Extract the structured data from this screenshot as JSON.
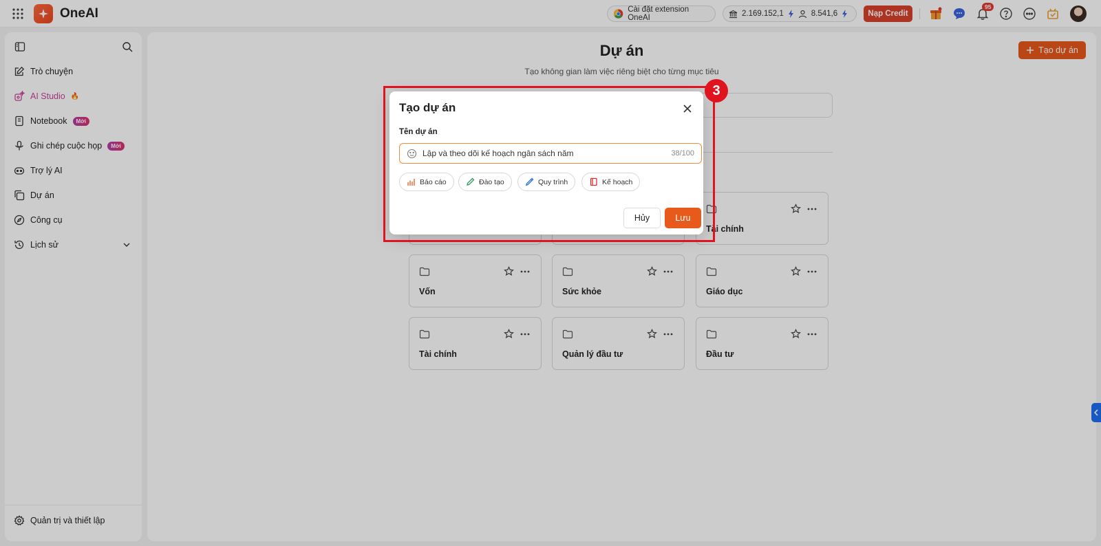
{
  "app": {
    "brand": "OneAI"
  },
  "topbar": {
    "extension_label": "Cài đặt extension OneAI",
    "credit_balance": "2.169.152,1",
    "user_credit": "8.541,6",
    "nap_credit_label": "Nạp Credit",
    "notification_count": "95"
  },
  "sidebar": {
    "items": [
      {
        "label": "Trò chuyện"
      },
      {
        "label": "AI Studio",
        "badge": "🔥"
      },
      {
        "label": "Notebook",
        "badge": "Mới"
      },
      {
        "label": "Ghi chép cuộc họp",
        "badge": "Mới"
      },
      {
        "label": "Trợ lý AI"
      },
      {
        "label": "Dự án"
      },
      {
        "label": "Công cụ"
      },
      {
        "label": "Lịch sử"
      }
    ],
    "bottom_label": "Quản trị và thiết lập"
  },
  "main": {
    "title": "Dự án",
    "subtitle": "Tạo không gian làm việc riêng biệt cho từng mục tiêu",
    "create_button": "Tạo dự án",
    "projects": [
      {
        "name": ""
      },
      {
        "name": ""
      },
      {
        "name": "Tài chính"
      },
      {
        "name": "Vốn"
      },
      {
        "name": "Sức khỏe"
      },
      {
        "name": "Giáo dục"
      },
      {
        "name": "Tài chính"
      },
      {
        "name": "Quản lý đầu tư"
      },
      {
        "name": "Đầu tư"
      }
    ]
  },
  "modal": {
    "title": "Tạo dự án",
    "field_label": "Tên dự án",
    "input_value": "Lập và theo dõi kế hoạch ngân sách năm",
    "char_count": "38/100",
    "suggestions": [
      {
        "label": "Báo cáo",
        "icon": "chart-icon",
        "color": "#e8591c"
      },
      {
        "label": "Đào tạo",
        "icon": "pencil-icon",
        "color": "#2e9e5b"
      },
      {
        "label": "Quy trình",
        "icon": "pen-icon",
        "color": "#2f6fe0"
      },
      {
        "label": "Kế hoạch",
        "icon": "book-icon",
        "color": "#d62f2f"
      }
    ],
    "cancel_label": "Hủy",
    "save_label": "Lưu"
  },
  "annotation": {
    "step": "3"
  },
  "colors": {
    "accent": "#e8591c",
    "highlight": "#e0141e",
    "studio": "#c8429b"
  }
}
